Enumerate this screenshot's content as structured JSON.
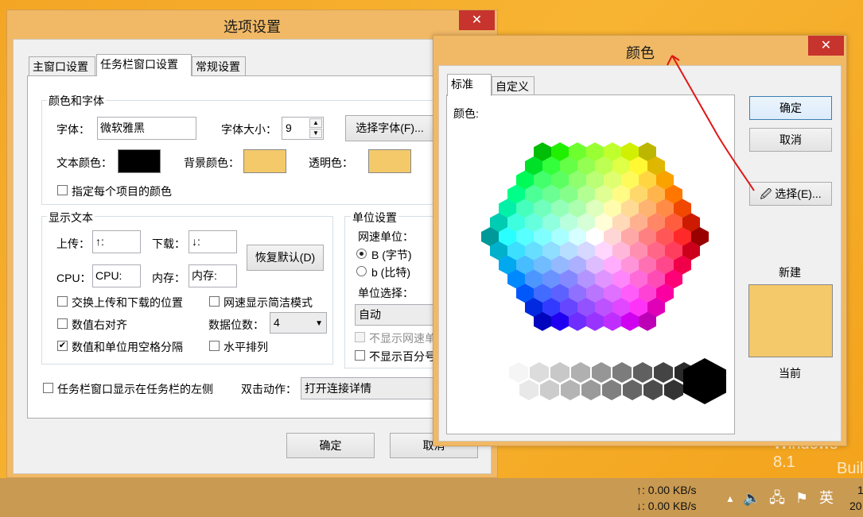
{
  "desktop": {
    "watermark_line1": "Windows 8.1",
    "watermark_line2": "Buil"
  },
  "taskbar": {
    "upload_speed": "↑: 0.00 KB/s",
    "download_speed": "↓: 0.00 KB/s",
    "ime_label": "英",
    "clock_fragment_top": "1",
    "clock_fragment_bottom": "20"
  },
  "options_dialog": {
    "title": "选项设置",
    "close_glyph": "✕",
    "tabs": [
      {
        "label": "主窗口设置"
      },
      {
        "label": "任务栏窗口设置"
      },
      {
        "label": "常规设置"
      }
    ],
    "color_font_group": {
      "label": "颜色和字体",
      "font_label": "字体：",
      "font_value": "微软雅黑",
      "font_size_label": "字体大小：",
      "font_size_value": "9",
      "choose_font_button": "选择字体(F)...",
      "text_color_label": "文本颜色：",
      "bg_color_label": "背景颜色：",
      "transparent_label": "透明色：",
      "per_item_color_label": "指定每个项目的颜色",
      "per_item_color_checked": false,
      "text_color": "#000000",
      "bg_color": "#f3c96a",
      "transparent_color": "#f3c96a"
    },
    "display_text_group": {
      "label": "显示文本",
      "upload_label": "上传：",
      "upload_value": "↑:",
      "download_label": "下载：",
      "download_value": "↓:",
      "cpu_label": "CPU：",
      "cpu_value": "CPU:",
      "memory_label": "内存：",
      "memory_value": "内存:",
      "restore_default_button": "恢复默认(D)",
      "swap_updown_label": "交换上传和下载的位置",
      "swap_updown_checked": false,
      "simple_speed_label": "网速显示简洁模式",
      "simple_speed_checked": false,
      "right_align_label": "数值右对齐",
      "right_align_checked": false,
      "digits_label": "数据位数：",
      "digits_value": "4",
      "space_separate_label": "数值和单位用空格分隔",
      "space_separate_checked": true,
      "horizontal_label": "水平排列",
      "horizontal_checked": false
    },
    "unit_group": {
      "label": "单位设置",
      "speed_unit_label": "网速单位：",
      "unit_B_label": "B (字节)",
      "unit_b_label": "b (比特)",
      "unit_select_label": "单位选择：",
      "unit_select_value": "自动",
      "hide_speed_unit_label": "不显示网速单",
      "hide_percent_label": "不显示百分号"
    },
    "taskbar_left_label": "任务栏窗口显示在任务栏的左侧",
    "double_click_label": "双击动作：",
    "double_click_value": "打开连接详情",
    "ok_button": "确定",
    "cancel_button": "取消"
  },
  "color_dialog": {
    "title": "颜色",
    "close_glyph": "✕",
    "tabs": [
      {
        "label": "标准"
      },
      {
        "label": "自定义"
      }
    ],
    "colors_label": "颜色:",
    "ok_button": "确定",
    "cancel_button": "取消",
    "pick_button": "选择(E)...",
    "new_label": "新建",
    "current_label": "当前",
    "new_color": "#f3c96a",
    "current_color": "#f3c96a"
  }
}
